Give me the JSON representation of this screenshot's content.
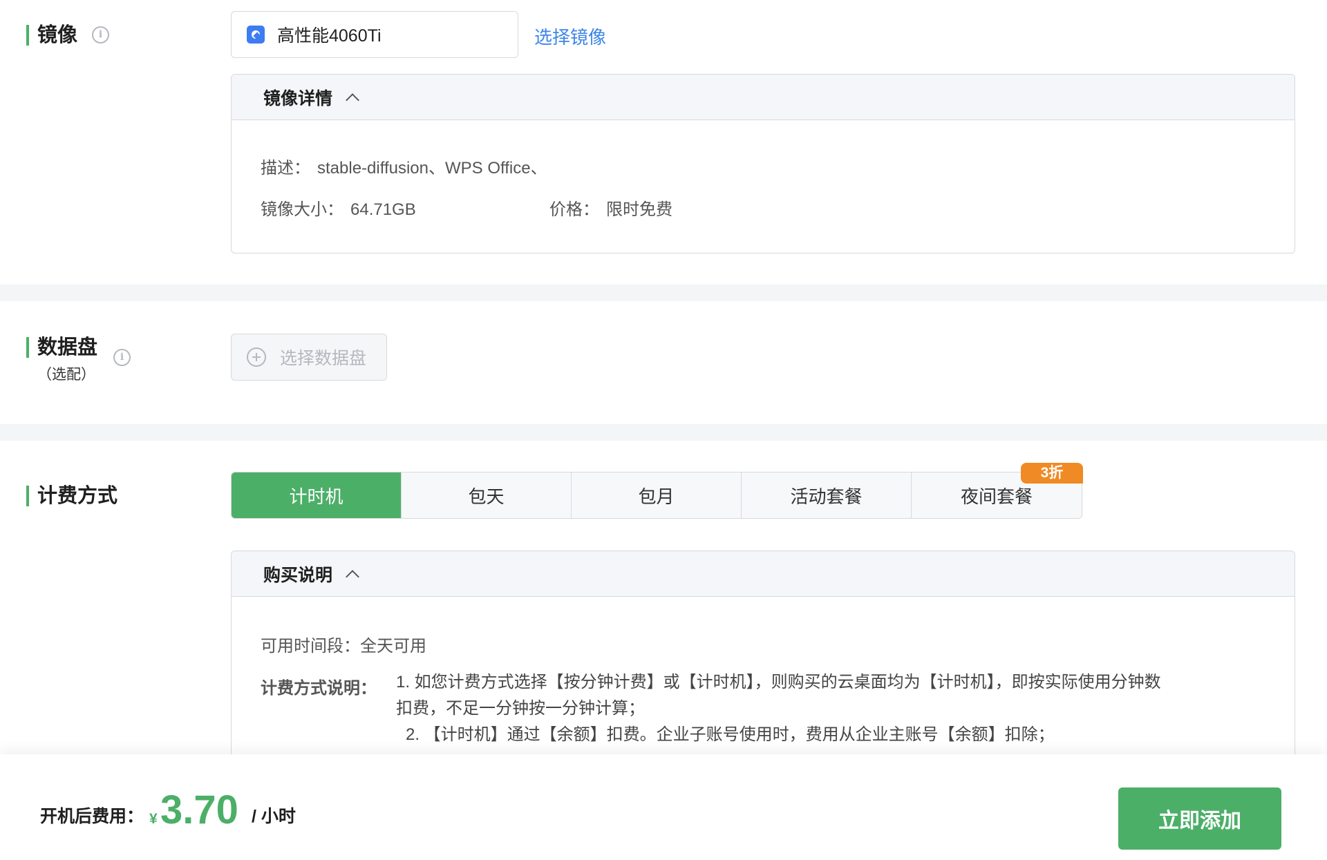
{
  "image_section": {
    "label": "镜像",
    "selected_image": "高性能4060Ti",
    "select_link": "选择镜像",
    "details": {
      "title": "镜像详情",
      "desc_label": "描述：",
      "desc_value": "stable-diffusion、WPS Office、",
      "size_label": "镜像大小：",
      "size_value": "64.71GB",
      "price_label": "价格：",
      "price_value": "限时免费"
    }
  },
  "disk_section": {
    "label": "数据盘",
    "optional": "（选配）",
    "button": "选择数据盘"
  },
  "billing_section": {
    "label": "计费方式",
    "tabs": [
      {
        "label": "计时机",
        "active": true
      },
      {
        "label": "包天",
        "active": false
      },
      {
        "label": "包月",
        "active": false
      },
      {
        "label": "活动套餐",
        "active": false
      },
      {
        "label": "夜间套餐",
        "active": false,
        "badge": "3折"
      }
    ],
    "purchase": {
      "title": "购买说明",
      "time_label": "可用时间段：",
      "time_value": "全天可用",
      "method_label": "计费方式说明：",
      "line1": "1. 如您计费方式选择【按分钟计费】或【计时机】，则购买的云桌面均为【计时机】，即按实际使用分钟数",
      "line1b": "扣费，不足一分钟按一分钟计算；",
      "line2": "2. 【计时机】通过【余额】扣费。企业子账号使用时，费用从企业主账号【余额】扣除；"
    }
  },
  "footer": {
    "fee_label": "开机后费用：",
    "currency": "¥",
    "amount": "3.70",
    "unit": "/ 小时",
    "add_button": "立即添加"
  },
  "colors": {
    "accent": "#4caf68",
    "link": "#3d86e8",
    "badge": "#f08a24"
  }
}
